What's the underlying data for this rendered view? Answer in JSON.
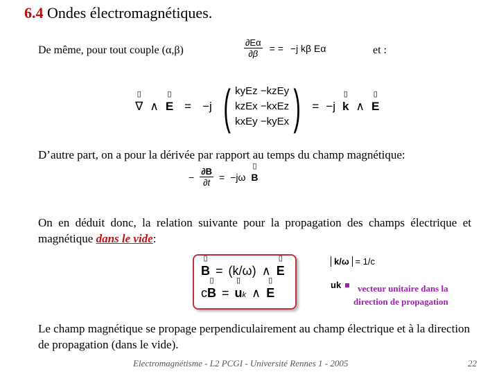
{
  "title": {
    "number": "6.4",
    "text": "Ondes électromagnétiques."
  },
  "intro": {
    "text": "De même, pour tout couple (α,β)",
    "equation": {
      "numerator": "∂Eα",
      "denominator": "∂β",
      "middle": "=  =",
      "rhs": "−j kβ Eα"
    },
    "trailing": "et :"
  },
  "curl_equation": {
    "lhs": {
      "nabla": "∇",
      "wedge": "∧",
      "E": "E"
    },
    "equals": "=",
    "factor": "−j",
    "matrix_rows": [
      "kyEz −kzEy",
      "kzEx −kxEz",
      "kxEy −kyEx"
    ],
    "rhs": {
      "equals": "=",
      "factor": "−j",
      "k": "k",
      "wedge": "∧",
      "E": "E"
    }
  },
  "paragraph1": "D’autre part, on a pour la dérivée par rapport au temps du champ magnétique:",
  "time_derivative": {
    "sign": "−",
    "numerator": "∂B",
    "denominator": "∂t",
    "equals": "=",
    "rhs": "−jω",
    "B": "B"
  },
  "paragraph2": {
    "text": "On en déduit donc, la relation suivante pour la propagation des champs électrique et magnétique ",
    "emphasis": "dans le vide",
    "end": ":"
  },
  "boxed_relations": {
    "row1": {
      "B": "B",
      "equals": "=",
      "middle": "(k/ω)",
      "wedge": "∧",
      "E": "E"
    },
    "row2": {
      "c": "c",
      "B": "B",
      "equals": "=",
      "u": "u",
      "sub": "k",
      "wedge": "∧",
      "E": "E"
    }
  },
  "side_notes": {
    "modulus": "k/ω",
    "modulus_value": "= 1/c",
    "uk": "uk",
    "description_line1": "vecteur unitaire dans la",
    "description_line2": "direction de propagation",
    "accent_color": "#a020b0"
  },
  "paragraph3": "Le champ magnétique se propage perpendiculairement au champ électrique et à la direction de propagation (dans le vide).",
  "footer": {
    "text": "Electromagnétisme - L2 PCGI - Université Rennes 1 - 2005",
    "page": "22"
  }
}
